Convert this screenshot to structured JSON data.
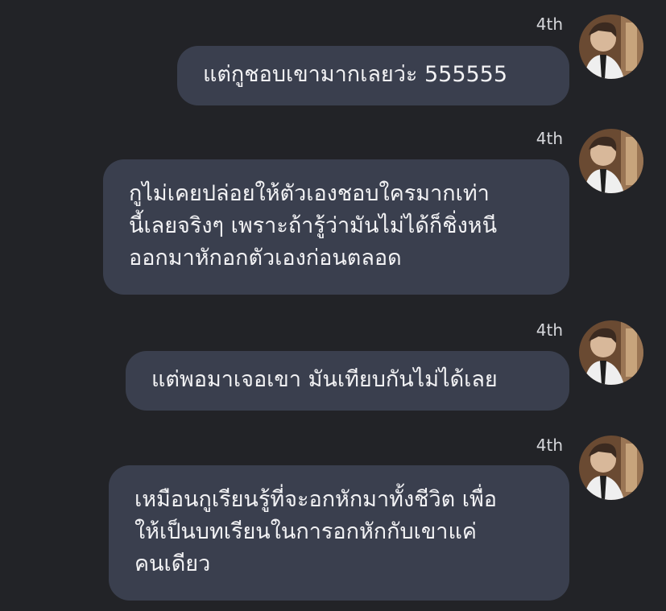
{
  "messages": [
    {
      "sender": "4th",
      "text": "แต่กูชอบเขามากเลยว่ะ 555555"
    },
    {
      "sender": "4th",
      "text": "กูไม่เคยปล่อยให้ตัวเองชอบใครมากเท่า\nนี้เลยจริงๆ เพราะถ้ารู้ว่ามันไม่ได้ก็ชิ่งหนี\nออกมาหักอกตัวเองก่อนตลอด"
    },
    {
      "sender": "4th",
      "text": "แต่พอมาเจอเขา มันเทียบกันไม่ได้เลย"
    },
    {
      "sender": "4th",
      "text": "เหมือนกูเรียนรู้ที่จะอกหักมาทั้งชีวิต เพื่อ\nให้เป็นบทเรียนในการอกหักกับเขาแค่\nคนเดียว"
    }
  ],
  "colors": {
    "background": "#222327",
    "bubble": "#3a3f4e",
    "text": "#f2f2f4",
    "sender": "#d6d7db"
  },
  "icons": {
    "avatar": "profile-photo-avatar"
  }
}
